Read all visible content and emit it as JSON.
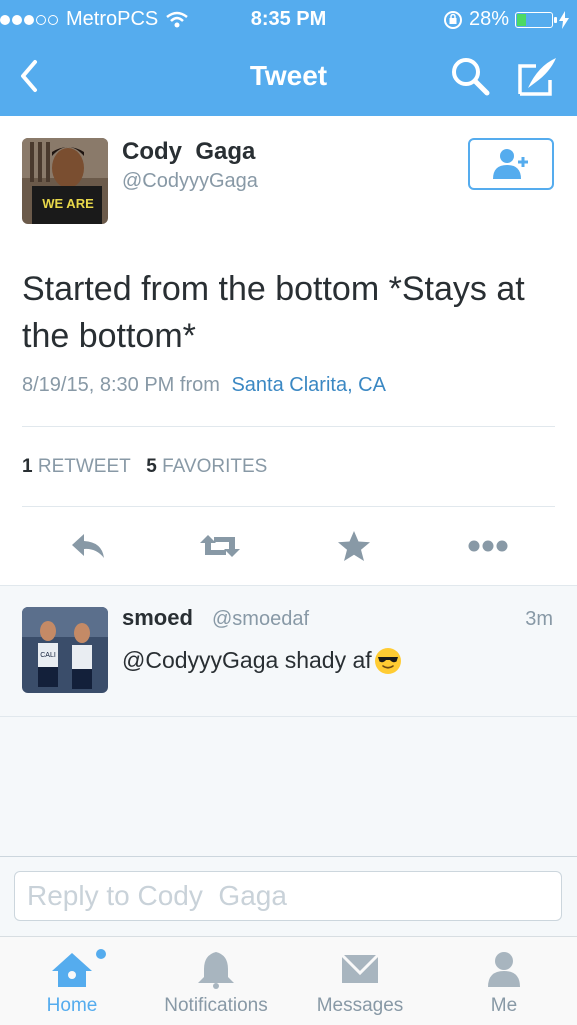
{
  "status_bar": {
    "carrier": "MetroPCS",
    "time": "8:35 PM",
    "battery": "28%",
    "battery_level": 0.28
  },
  "nav": {
    "title": "Tweet"
  },
  "tweet": {
    "name": "Cody  Gaga",
    "handle": "@CodyyyGaga",
    "avatar_shirt_text": "WE ARE",
    "text": "Started from the bottom *Stays at the bottom*",
    "timestamp": "8/19/15, 8:30 PM",
    "from_label": "from",
    "location": "Santa Clarita, CA",
    "retweets_count": "1",
    "retweets_label": "RETWEET",
    "favorites_count": "5",
    "favorites_label": "FAVORITES"
  },
  "reply_item": {
    "name": "smoed",
    "handle": "@smoedaf",
    "time": "3m",
    "text": "@CodyyyGaga shady af",
    "avatar_jersey_text": "CALI"
  },
  "reply_box": {
    "placeholder": "Reply to Cody  Gaga"
  },
  "tabs": [
    {
      "label": "Home",
      "icon": "home-icon",
      "active": true
    },
    {
      "label": "Notifications",
      "icon": "bell-icon",
      "active": false
    },
    {
      "label": "Messages",
      "icon": "envelope-icon",
      "active": false
    },
    {
      "label": "Me",
      "icon": "person-icon",
      "active": false
    }
  ],
  "colors": {
    "brand": "#55acee",
    "link": "#3b88c3",
    "text": "#292f33",
    "muted": "#8899a6"
  }
}
